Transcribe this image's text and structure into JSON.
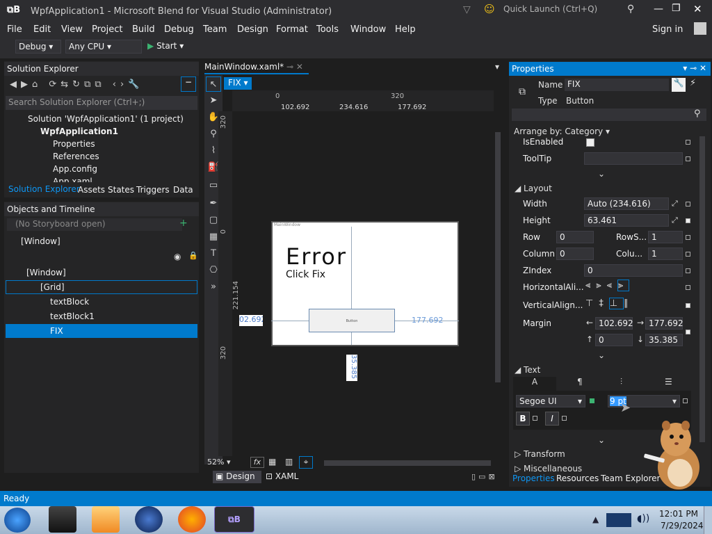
{
  "window": {
    "title": "WpfApplication1 - Microsoft Blend for Visual Studio (Administrator)",
    "quick_launch_placeholder": "Quick Launch (Ctrl+Q)",
    "sign_in": "Sign in"
  },
  "menu": [
    "File",
    "Edit",
    "View",
    "Project",
    "Build",
    "Debug",
    "Team",
    "Design",
    "Format",
    "Tools",
    "Window",
    "Help"
  ],
  "toolbar": {
    "config": "Debug",
    "platform": "Any CPU",
    "start": "Start"
  },
  "solution_explorer": {
    "title": "Solution Explorer",
    "search_placeholder": "Search Solution Explorer (Ctrl+;)",
    "items": [
      "Solution 'WpfApplication1' (1 project)",
      "WpfApplication1",
      "Properties",
      "References",
      "App.config",
      "App.xaml"
    ],
    "tabs": [
      "Solution Explorer",
      "Assets",
      "States",
      "Triggers",
      "Data"
    ]
  },
  "objects_timeline": {
    "title": "Objects and Timeline",
    "storyboard": "(No Storyboard open)",
    "root": "[Window]",
    "tree": [
      "[Window]",
      "[Grid]",
      "textBlock",
      "textBlock1",
      "FIX"
    ]
  },
  "editor": {
    "tab": "MainWindow.xaml*",
    "selected_element": "FIX",
    "ruler_top": [
      "0",
      "320"
    ],
    "ruler_left": [
      "320",
      "0",
      "320"
    ],
    "margins": {
      "left": "102.692",
      "width": "234.616",
      "right": "177.692",
      "height_side": "221.154",
      "bottom": "35.385",
      "left_field": "02.692",
      "right_field": "177.692"
    },
    "window_caption": "MainWindow",
    "canvas_heading": "Error",
    "canvas_sub": "Click Fix",
    "button_text": "Button",
    "zoom": "52%",
    "fx": "fx",
    "view_tabs": [
      "Design",
      "XAML"
    ]
  },
  "properties": {
    "title": "Properties",
    "name_label": "Name",
    "name_value": "FIX",
    "type_label": "Type",
    "type_value": "Button",
    "arrange": "Arrange by: Category",
    "isenabled": "IsEnabled",
    "tooltip": "ToolTip",
    "layout": "Layout",
    "width_label": "Width",
    "width_value": "Auto (234.616)",
    "height_label": "Height",
    "height_value": "63.461",
    "row_label": "Row",
    "row_value": "0",
    "rowspan_label": "RowS...",
    "rowspan_value": "1",
    "column_label": "Column",
    "column_value": "0",
    "colspan_label": "Colu...",
    "colspan_value": "1",
    "zindex_label": "ZIndex",
    "zindex_value": "0",
    "halign_label": "HorizontalAli...",
    "valign_label": "VerticalAlign...",
    "margin_label": "Margin",
    "margin_left": "102.692",
    "margin_right": "177.692",
    "margin_top": "0",
    "margin_bottom": "35.385",
    "text_section": "Text",
    "font": "Segoe UI",
    "font_size": "9 pt",
    "bold": "B",
    "italic": "I",
    "transform": "Transform",
    "misc": "Miscellaneous",
    "bottom_tabs": [
      "Properties",
      "Resources",
      "Team Explorer"
    ]
  },
  "status": "Ready",
  "clock": {
    "time": "12:01 PM",
    "date": "7/29/2024"
  },
  "colors": {
    "accent": "#007acc",
    "bg": "#1e1e1e",
    "panel": "#252526"
  }
}
